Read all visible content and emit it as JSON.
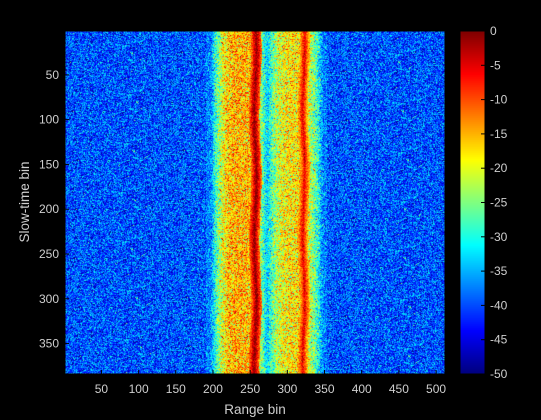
{
  "chart_data": {
    "type": "heatmap",
    "title": "",
    "xlabel": "Range bin",
    "ylabel": "Slow-time bin",
    "xlim": [
      1,
      512
    ],
    "ylim": [
      1,
      384
    ],
    "y_reversed": true,
    "x_ticks": [
      50,
      100,
      150,
      200,
      250,
      300,
      350,
      400,
      450,
      500
    ],
    "y_ticks": [
      50,
      100,
      150,
      200,
      250,
      300,
      350
    ],
    "colormap": "jet",
    "clim": [
      -50,
      0
    ],
    "colorbar_ticks": [
      0,
      -5,
      -10,
      -15,
      -20,
      -25,
      -30,
      -35,
      -40,
      -45,
      -50
    ],
    "noise_floor_db": -40,
    "bands": [
      {
        "x_start": 197,
        "x_end": 275,
        "peak_db": -15
      },
      {
        "x_start": 270,
        "x_end": 348,
        "peak_db": -18
      }
    ],
    "scatterers": [
      {
        "x": 257,
        "peak_db": 0
      },
      {
        "x": 322,
        "peak_db": -5
      }
    ],
    "background_color": "#000000"
  }
}
